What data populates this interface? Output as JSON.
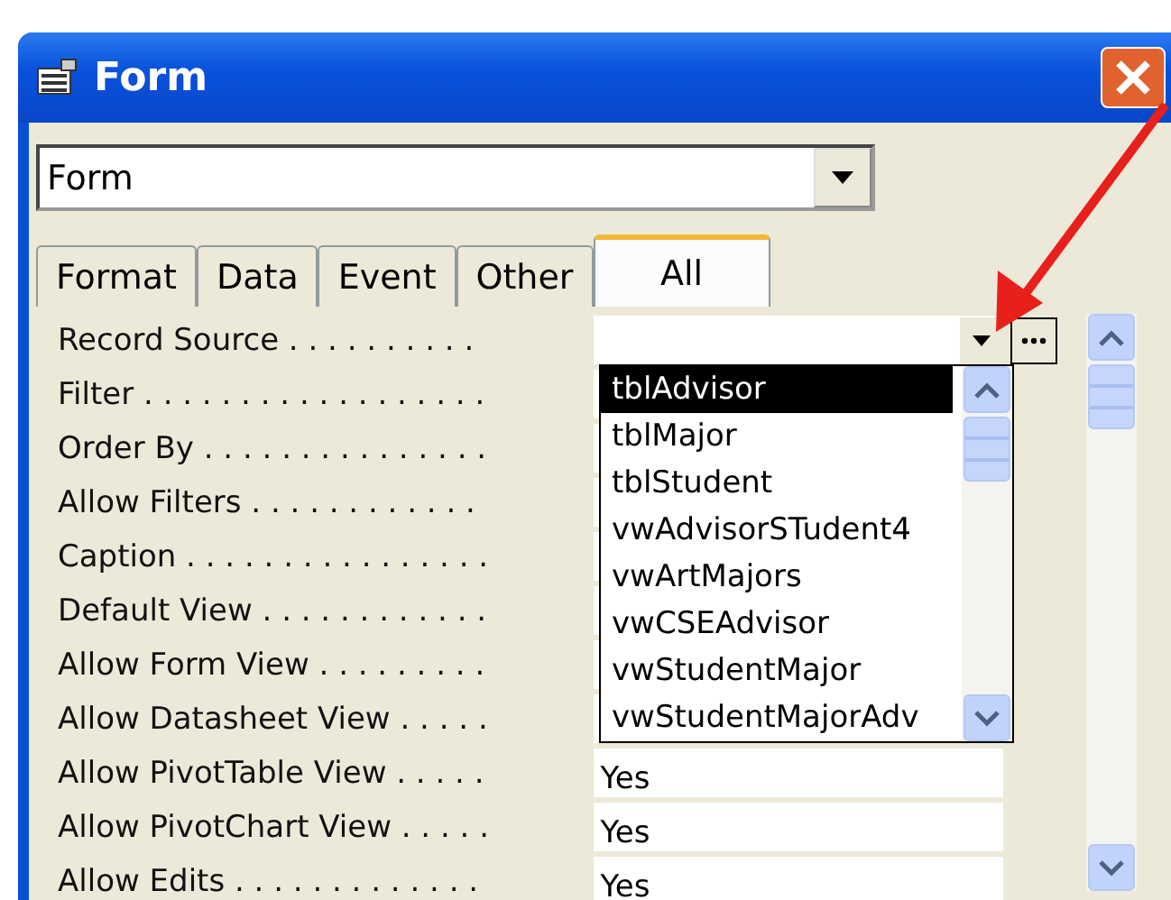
{
  "window": {
    "title": "Form"
  },
  "object_selector": {
    "value": "Form"
  },
  "tabs": [
    {
      "label": "Format",
      "selected": false
    },
    {
      "label": "Data",
      "selected": false
    },
    {
      "label": "Event",
      "selected": false
    },
    {
      "label": "Other",
      "selected": false
    },
    {
      "label": "All",
      "selected": true
    }
  ],
  "properties": [
    {
      "label": "Record Source . . . . . . . . . .",
      "kind": "lookup"
    },
    {
      "label": "Filter . . . . . . . . . . . . . . . . . .",
      "kind": "plain"
    },
    {
      "label": "Order By . . . . . . . . . . . . . . .",
      "kind": "plain"
    },
    {
      "label": "Allow Filters . . . . . . . . . . . .",
      "kind": "plain"
    },
    {
      "label": "Caption . . . . . . . . . . . . . . . .",
      "kind": "plain"
    },
    {
      "label": "Default View . . . . . . . . . . . .",
      "kind": "plain"
    },
    {
      "label": "Allow Form View . . . . . . . . .",
      "kind": "plain"
    },
    {
      "label": "Allow Datasheet View . . . . .",
      "kind": "plain"
    },
    {
      "label": "Allow PivotTable View . . . . .",
      "value": "Yes",
      "kind": "plain"
    },
    {
      "label": "Allow PivotChart View . . . . .",
      "value": "Yes",
      "kind": "plain"
    },
    {
      "label": "Allow Edits . . . . . . . . . . . . .",
      "value": "Yes",
      "kind": "plain"
    }
  ],
  "dropdown": {
    "items": [
      {
        "label": "tblAdvisor",
        "selected": true
      },
      {
        "label": "tblMajor",
        "selected": false
      },
      {
        "label": "tblStudent",
        "selected": false
      },
      {
        "label": "vwAdvisorSTudent4",
        "selected": false
      },
      {
        "label": "vwArtMajors",
        "selected": false
      },
      {
        "label": "vwCSEAdvisor",
        "selected": false
      },
      {
        "label": "vwStudentMajor",
        "selected": false
      },
      {
        "label": "vwStudentMajorAdv",
        "selected": false
      }
    ]
  }
}
